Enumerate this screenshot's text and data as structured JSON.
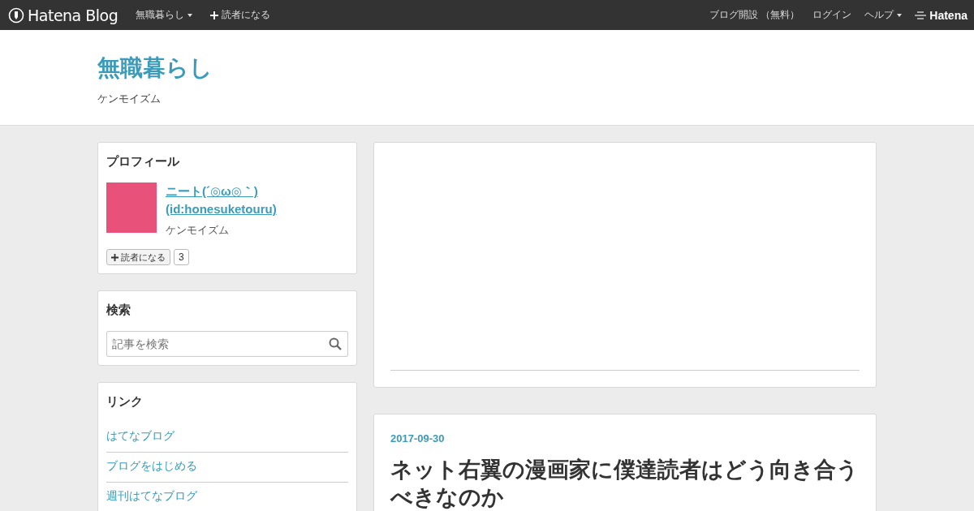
{
  "topbar": {
    "logo": "Hatena Blog",
    "blog_menu": "無職暮らし",
    "subscribe": "読者になる",
    "right_links": [
      "ブログ開設 （無料）",
      "ログイン"
    ],
    "help": "ヘルプ",
    "brand": "Hatena"
  },
  "header": {
    "title": "無職暮らし",
    "subtitle": "ケンモイズム"
  },
  "profile": {
    "heading": "プロフィール",
    "name": "ニート(´◎ω◎｀)",
    "id": "(id:honesuketouru)",
    "description": "ケンモイズム",
    "subscribe_button": "読者になる",
    "subscriber_count": "3"
  },
  "search": {
    "heading": "検索",
    "placeholder": "記事を検索"
  },
  "links": {
    "heading": "リンク",
    "items": [
      "はてなブログ",
      "ブログをはじめる",
      "週刊はてなブログ"
    ]
  },
  "article": {
    "date": "2017-09-30",
    "title": "ネット右翼の漫画家に僕達読者はどう向き合うべきなのか"
  }
}
